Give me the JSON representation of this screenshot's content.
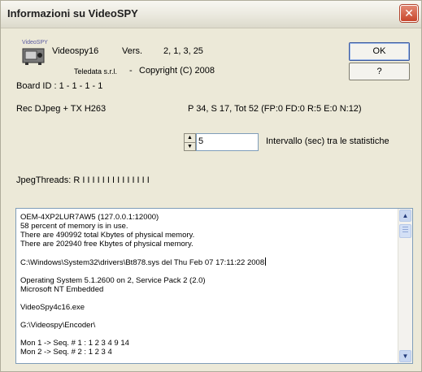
{
  "window": {
    "title": "Informazioni su VideoSPY",
    "close_glyph": "✕"
  },
  "info": {
    "logo_text": "VideoSPY",
    "app_name": "Videospy16",
    "vers_label": "Vers.",
    "version": "2, 1, 3, 25",
    "company": "Teledata s.r.l.",
    "sep": "-",
    "copyright": "Copyright (C) 2008",
    "board_id": "Board ID :  1 - 1 - 1 - 1",
    "rec": "Rec DJpeg + TX H263",
    "stats": "P 34, S 17, Tot 52 (FP:0 FD:0 R:5 E:0 N:12)",
    "jpeg_threads": "JpegThreads: R I I I I I I I I I I I I I I"
  },
  "buttons": {
    "ok": "OK",
    "help": "?"
  },
  "interval": {
    "value": "5",
    "label": "Intervallo (sec) tra le statistiche"
  },
  "log": {
    "lines": [
      "OEM-4XP2LUR7AW5 (127.0.0.1:12000)",
      "58 percent of memory is in use.",
      "There are  490992 total Kbytes of physical memory.",
      "There are  202940 free Kbytes of physical memory.",
      "",
      "C:\\Windows\\System32\\drivers\\Bt878.sys del Thu Feb 07 17:11:22 2008",
      "",
      "Operating System 5.1.2600 on 2, Service Pack 2 (2.0)",
      "Microsoft NT Embedded",
      "",
      "VideoSpy4c16.exe",
      "",
      "G:\\Videospy\\Encoder\\",
      "",
      "Mon 1 -> Seq. # 1 :  1 2 3 4 9 14",
      "Mon 2 -> Seq. # 2 :  1 2 3 4"
    ]
  },
  "colors": {
    "close_red": "#c8452b",
    "frame": "#ece9d8"
  }
}
